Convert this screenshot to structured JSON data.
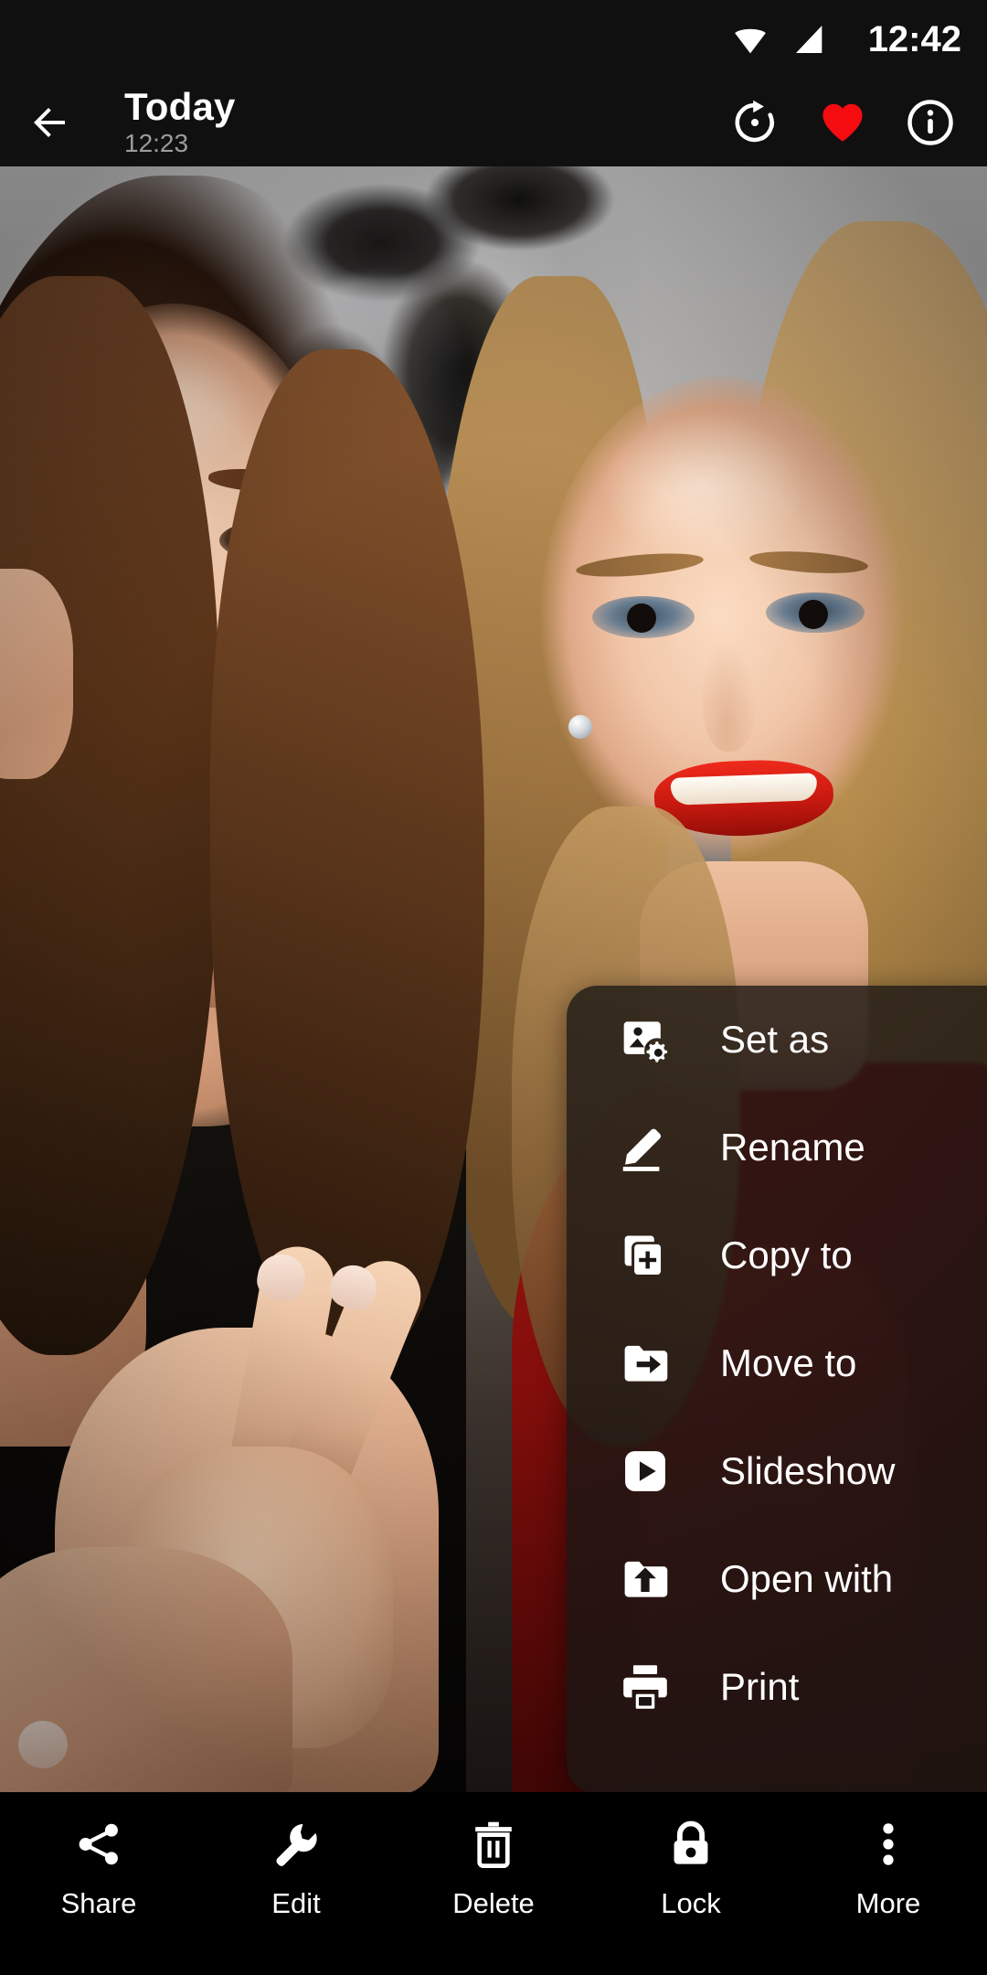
{
  "status_bar": {
    "clock": "12:42",
    "icons": [
      "wifi-icon",
      "signal-icon"
    ]
  },
  "app_bar": {
    "back_icon": "back-arrow-icon",
    "title": "Today",
    "subtitle": "12:23",
    "actions": [
      {
        "name": "rotate-icon",
        "label": "Rotate"
      },
      {
        "name": "favorite-heart-icon",
        "label": "Favorite",
        "color": "#f40c10"
      },
      {
        "name": "info-icon",
        "label": "Info"
      }
    ]
  },
  "popup_menu": {
    "items": [
      {
        "icon": "set-as-wallpaper-icon",
        "label": "Set as"
      },
      {
        "icon": "rename-pencil-icon",
        "label": "Rename"
      },
      {
        "icon": "copy-to-icon",
        "label": "Copy to"
      },
      {
        "icon": "move-to-folder-icon",
        "label": "Move to"
      },
      {
        "icon": "slideshow-play-icon",
        "label": "Slideshow"
      },
      {
        "icon": "open-with-icon",
        "label": "Open with"
      },
      {
        "icon": "print-icon",
        "label": "Print"
      }
    ]
  },
  "bottom_bar": {
    "items": [
      {
        "icon": "share-icon",
        "label": "Share"
      },
      {
        "icon": "edit-wrench-icon",
        "label": "Edit"
      },
      {
        "icon": "delete-trash-icon",
        "label": "Delete"
      },
      {
        "icon": "lock-icon",
        "label": "Lock"
      },
      {
        "icon": "more-vertical-icon",
        "label": "More"
      }
    ]
  },
  "photo": {
    "description": "Two smiling young women posing, one with brown hair in a black top making a peace sign, one blonde in a red dress, with silver balloons in the background"
  }
}
